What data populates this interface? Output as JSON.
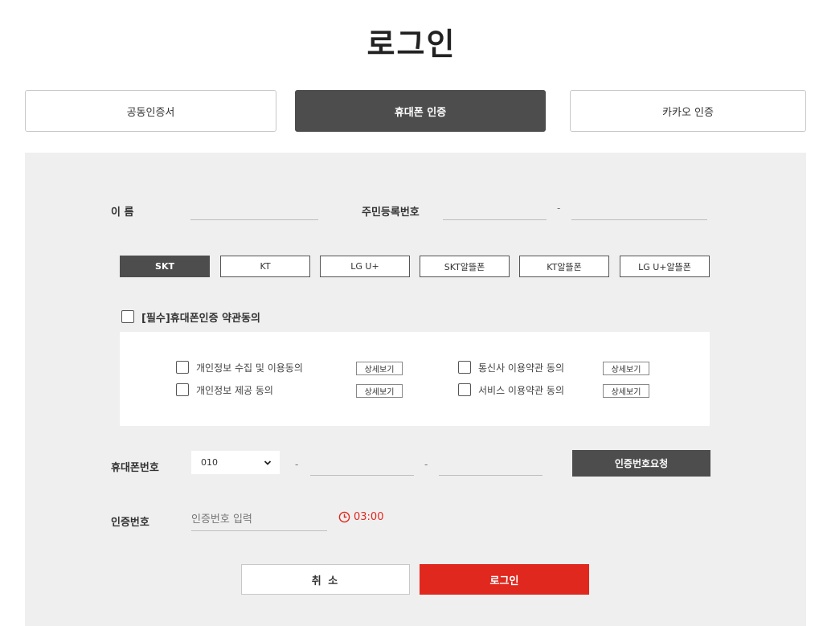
{
  "page": {
    "title": "로그인"
  },
  "tabs": [
    {
      "label": "공동인증서",
      "active": false
    },
    {
      "label": "휴대폰 인증",
      "active": true
    },
    {
      "label": "카카오 인증",
      "active": false
    }
  ],
  "form": {
    "name_label": "이 름",
    "name_value": "",
    "rrn_label": "주민등록번호",
    "rrn_front_value": "",
    "rrn_separator": "-",
    "rrn_back_value": ""
  },
  "carriers": [
    {
      "label": "SKT",
      "active": true
    },
    {
      "label": "KT",
      "active": false
    },
    {
      "label": "LG U+",
      "active": false
    },
    {
      "label": "SKT알뜰폰",
      "active": false
    },
    {
      "label": "KT알뜰폰",
      "active": false
    },
    {
      "label": "LG U+알뜰폰",
      "active": false
    }
  ],
  "agreement": {
    "main_label": "[필수]휴대폰인증 약관동의",
    "items": [
      {
        "label": "개인정보 수집 및 이용동의",
        "detail": "상세보기"
      },
      {
        "label": "통신사 이용약관 동의",
        "detail": "상세보기"
      },
      {
        "label": "개인정보 제공 동의",
        "detail": "상세보기"
      },
      {
        "label": "서비스 이용약관 동의",
        "detail": "상세보기"
      }
    ]
  },
  "phone": {
    "label": "휴대폰번호",
    "prefix_selected": "010",
    "separator": "-",
    "middle_value": "",
    "last_value": "",
    "request_button": "인증번호요청"
  },
  "verify": {
    "label": "인증번호",
    "placeholder": "인증번호 입력",
    "timer": "03:00"
  },
  "actions": {
    "cancel": "취 소",
    "login": "로그인"
  },
  "colors": {
    "accent": "#e0281e",
    "dark": "#4d4d4d",
    "panel_bg": "#efefef"
  }
}
